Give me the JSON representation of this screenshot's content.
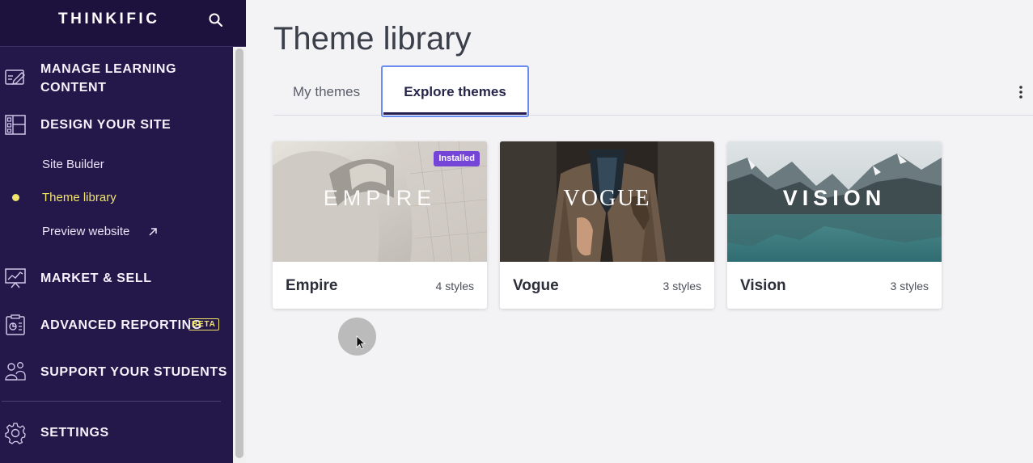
{
  "sidebar": {
    "logo": "THINKIFIC",
    "nav": {
      "manage_line1": "MANAGE LEARNING",
      "manage_line2": "CONTENT",
      "design": "DESIGN YOUR SITE",
      "market": "MARKET & SELL",
      "reporting": "ADVANCED REPORTING",
      "reporting_badge": "BETA",
      "support": "SUPPORT YOUR STUDENTS",
      "settings": "SETTINGS"
    },
    "sub_items": {
      "site_builder": "Site Builder",
      "theme_library": "Theme library",
      "preview_website": "Preview website"
    }
  },
  "main": {
    "title": "Theme library",
    "tabs": {
      "my_themes": "My themes",
      "explore_themes": "Explore themes"
    },
    "themes": [
      {
        "name": "Empire",
        "styles": "4 styles",
        "thumb_title": "EMPIRE",
        "badge": "Installed"
      },
      {
        "name": "Vogue",
        "styles": "3 styles",
        "thumb_title": "VOGUE"
      },
      {
        "name": "Vision",
        "styles": "3 styles",
        "thumb_title": "VISION"
      }
    ]
  },
  "colors": {
    "sidebar_bg": "#24174a",
    "active_accent": "#f0e46a",
    "installed_badge": "#7545d8",
    "tab_focus": "#6a8cf2"
  },
  "icons": {
    "search": "search-icon",
    "manage": "edit-board-icon",
    "design": "layout-icon",
    "market": "chart-board-icon",
    "reporting": "report-icon",
    "support": "students-icon",
    "settings": "gear-icon",
    "external": "external-link-icon",
    "more": "kebab-icon"
  }
}
